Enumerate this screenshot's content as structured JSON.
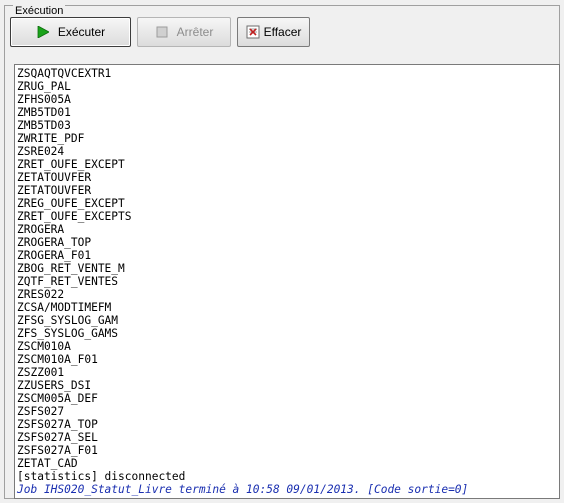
{
  "group": {
    "title": "Exécution"
  },
  "toolbar": {
    "execute_label": "Exécuter",
    "stop_label": "Arrêter",
    "clear_label": "Effacer",
    "execute_icon": "play-icon",
    "stop_icon": "stop-icon",
    "clear_icon": "eraser-icon",
    "accent_play": "#1aa31a"
  },
  "console": {
    "lines": [
      "ZSQAQTQVCEXTR1",
      "ZRUG_PAL",
      "ZFHS005A",
      "ZMB5TD01",
      "ZMB5TD03",
      "ZWRITE_PDF",
      "ZSRE024",
      "ZRET_OUFE_EXCEPT",
      "ZETATOUVFER",
      "ZETATOUVFER",
      "ZREG_OUFE_EXCEPT",
      "ZRET_OUFE_EXCEPTS",
      "ZROGERA",
      "ZROGERA_TOP",
      "ZROGERA_F01",
      "ZBOG_RET_VENTE_M",
      "ZQTF_RET_VENTES",
      "ZRES022",
      "ZCSA/MODTIMEFM",
      "ZFSG_SYSLOG_GAM",
      "ZFS_SYSLOG_GAMS",
      "ZSCM010A",
      "ZSCM010A_F01",
      "ZSZZ001",
      "ZZUSERS_DSI",
      "ZSCM005A_DEF",
      "ZSFS027",
      "ZSFS027A_TOP",
      "ZSFS027A_SEL",
      "ZSFS027A_F01",
      "ZETAT_CAD",
      "[statistics] disconnected"
    ],
    "status_line": "Job IHS020_Statut_Livre terminé à 10:58 09/01/2013. [Code sortie=0]",
    "status_color": "#1a2fb0"
  }
}
